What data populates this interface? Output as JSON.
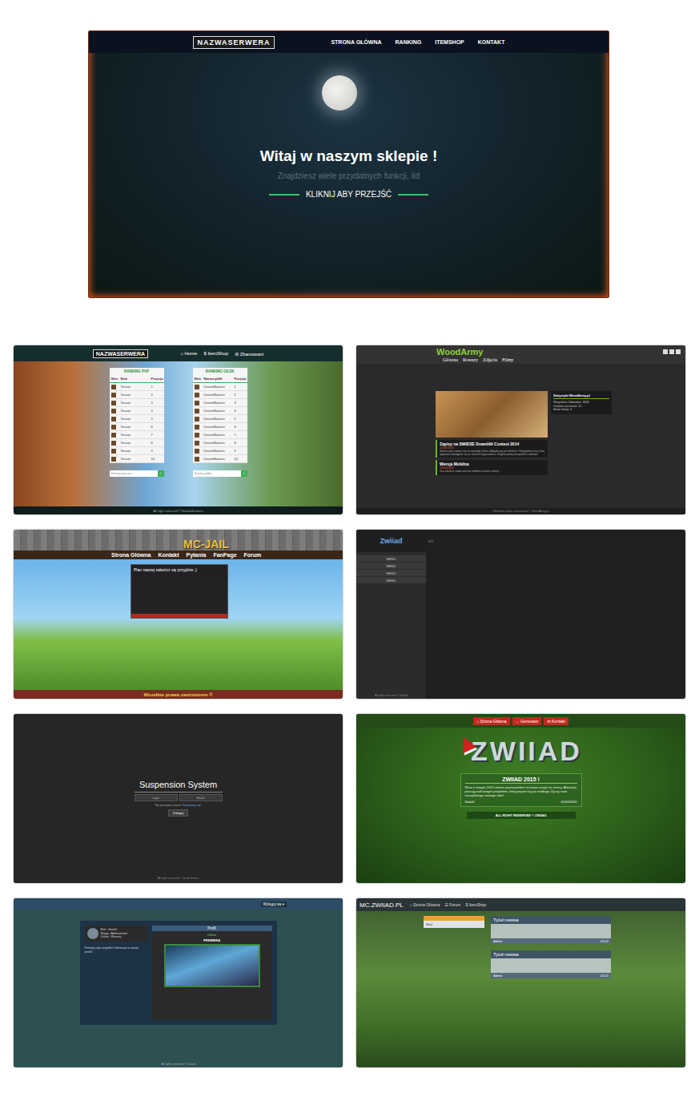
{
  "hero": {
    "logo": "NAZWASERWERA",
    "nav": [
      "STRONA GŁÓWNA",
      "RANKING",
      "ITEMSHOP",
      "KONTAKT"
    ],
    "title": "Witaj w naszym sklepie !",
    "subtitle": "Znajdziesz wiele przydatnych funkcji, itd",
    "button": "KLIKNIJ ABY PRZEJŚĆ"
  },
  "shots": [
    {
      "kind": "ranking",
      "logo": "NAZWASERWERA",
      "nav": [
        {
          "icon": "⌂",
          "label": "Home"
        },
        {
          "icon": "$",
          "label": "ItemShop"
        },
        {
          "icon": "⊘",
          "label": "Zbanowani"
        }
      ],
      "tables": [
        {
          "title": "RANKING PVP",
          "columns": [
            "Skin",
            "Nick",
            "Pozycja"
          ],
          "placeholder": "Szukaj gracza...",
          "button": "›",
          "rows": [
            {
              "name": "Tescior",
              "pos": "1"
            },
            {
              "name": "Tescior",
              "pos": "2"
            },
            {
              "name": "Tescior",
              "pos": "3"
            },
            {
              "name": "Tescior",
              "pos": "4"
            },
            {
              "name": "Tescior",
              "pos": "5"
            },
            {
              "name": "Tescior",
              "pos": "6"
            },
            {
              "name": "Tescior",
              "pos": "7"
            },
            {
              "name": "Tescior",
              "pos": "8"
            },
            {
              "name": "Tescior",
              "pos": "9"
            },
            {
              "name": "Tescior",
              "pos": "10"
            }
          ]
        },
        {
          "title": "RANKING GILDII",
          "columns": [
            "Skin",
            "Nazwa gildii",
            "Pozycja"
          ],
          "placeholder": "Szukaj gildii...",
          "button": "›",
          "rows": [
            {
              "name": "DreamMasters",
              "pos": "1"
            },
            {
              "name": "DreamMasters",
              "pos": "2"
            },
            {
              "name": "DreamMasters",
              "pos": "3"
            },
            {
              "name": "DreamMasters",
              "pos": "4"
            },
            {
              "name": "DreamMasters",
              "pos": "5"
            },
            {
              "name": "DreamMasters",
              "pos": "6"
            },
            {
              "name": "DreamMasters",
              "pos": "7"
            },
            {
              "name": "DreamMasters",
              "pos": "8"
            },
            {
              "name": "DreamMasters",
              "pos": "9"
            },
            {
              "name": "DreamMasters",
              "pos": "10"
            }
          ]
        }
      ],
      "footer": "All right reserved © NazwaSerwera"
    },
    {
      "kind": "blog",
      "logo": "WoodArmy",
      "nav": [
        "Główna",
        "Rowery",
        "Zdjęcia",
        "Filmy"
      ],
      "posts": [
        {
          "title": "Zapisy na SWIESE DownHill Contest 2014",
          "date": "12/04/2014",
          "body": "Koniecznie zapisz się na zawody, które odbędą się już wkrótce. Regulamin oraz lista zgłoszeń dostępne są na stronie organizatora. Zapraszamy wszystkich riderów!"
        },
        {
          "title": "Wersja Mobilna",
          "date": "10/04/2014",
          "body": "Już wkrótce nowa wersja mobilna naszej strony."
        }
      ],
      "sidebar": {
        "title": "Statystyki WoodArmy.pl",
        "lines": [
          "Wszystkich Odwiedzin: 3003",
          "Ostatnio na stronie: 12",
          "Nowe teksty: 4"
        ]
      },
      "footer": "Wszelkie prawa zastrzeżone © WoodArmy.pl"
    },
    {
      "kind": "jail",
      "logo": "MC-JAIL",
      "nav": [
        "Strona Główna",
        "Kontakt",
        "Pytania",
        "FanPage",
        "Forum"
      ],
      "box": "Plan naszej zakończ się przyjdzie ;)",
      "footer": "Wszelkie prawa zastrzeżone ©"
    },
    {
      "kind": "panel",
      "logo": "Zwiiad",
      "menu": [
        "MENU",
        "MENU",
        "MENU",
        "MENU"
      ],
      "counter": "325",
      "footer": "All right reserved © Zwiiad"
    },
    {
      "kind": "login",
      "title": "Suspension System",
      "fields": [
        "Login",
        "Hasło"
      ],
      "hint": "Nie posiadasz konta?",
      "link": "Zarejestruj się!",
      "button": "Zaloguj",
      "footer": "All right reserved © Jacob Szmer"
    },
    {
      "kind": "xmas",
      "nav": [
        {
          "icon": "⌂",
          "label": "Strona Główna"
        },
        {
          "icon": "⇔",
          "label": "Generator"
        },
        {
          "icon": "✉",
          "label": "Kontakt"
        }
      ],
      "logo": "ZWIIAD",
      "post": {
        "title": "ZWIIAD 2015 !",
        "body": "Wraz z nowym 2015 rokiem postanowiłem na nowo ruszyć ze stroną. Aktualnie pracuję nad nowym projektem, który pojawi się już niedługo. Życzę wam szczęśliwego nowego roku!",
        "author": "ZwiiaD",
        "date": "01/01/2015"
      },
      "footer": "ALL RIGHT RESERVED © ZWIIAD"
    },
    {
      "kind": "profile",
      "menu": "Wyloguj się ▾",
      "user": [
        "Nick : ZwiiaD",
        "Ranga : Administrator",
        "Online : Wczoraj"
      ],
      "note": "Pamiętaj aby uzupełnić informacje w swoim profilu!",
      "tab": "Profil",
      "status": "Online",
      "banner": "PREMIERA",
      "footer": "All rights reserved © Zwiiad"
    },
    {
      "kind": "news",
      "logo": "MC.ZWIIAD.PL",
      "nav": [
        {
          "icon": "⌂",
          "label": "Strona Główna"
        },
        {
          "icon": "☰",
          "label": "Forum"
        },
        {
          "icon": "$",
          "label": "ItemShop"
        }
      ],
      "side": [
        "Start"
      ],
      "news": [
        {
          "title": "Tytuł newsa",
          "author": "Admin",
          "date": "01.01"
        },
        {
          "title": "Tytuł newsa",
          "author": "Admin",
          "date": "02.01"
        }
      ]
    }
  ]
}
